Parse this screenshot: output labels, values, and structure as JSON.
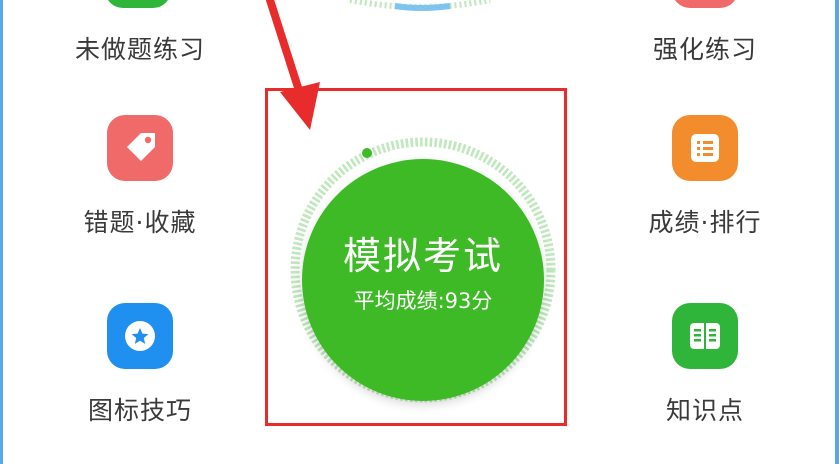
{
  "menu": {
    "top_left_label": "未做题练习",
    "top_right_label": "强化练习",
    "wrong_collect_label": "错题·收藏",
    "grades_ranking_label": "成绩·排行",
    "icon_tips_label": "图标技巧",
    "knowledge_label": "知识点"
  },
  "exam": {
    "title": "模拟考试",
    "average_score": "平均成绩:93分",
    "progress_fraction": 0.93
  },
  "colors": {
    "green_primary": "#3dba26",
    "ring_light": "#bfe8bd",
    "red_tile": "#f06a6a",
    "orange_tile": "#f28c2c",
    "blue_tile": "#1f8ff0",
    "green_tile": "#2fb63a",
    "highlight_red": "#e82c2c",
    "frame_blue": "#5aa8e6"
  },
  "icons": {
    "wrong_collect": "tag-icon",
    "grades_ranking": "list-icon",
    "icon_tips": "star-icon",
    "knowledge": "book-icon"
  }
}
